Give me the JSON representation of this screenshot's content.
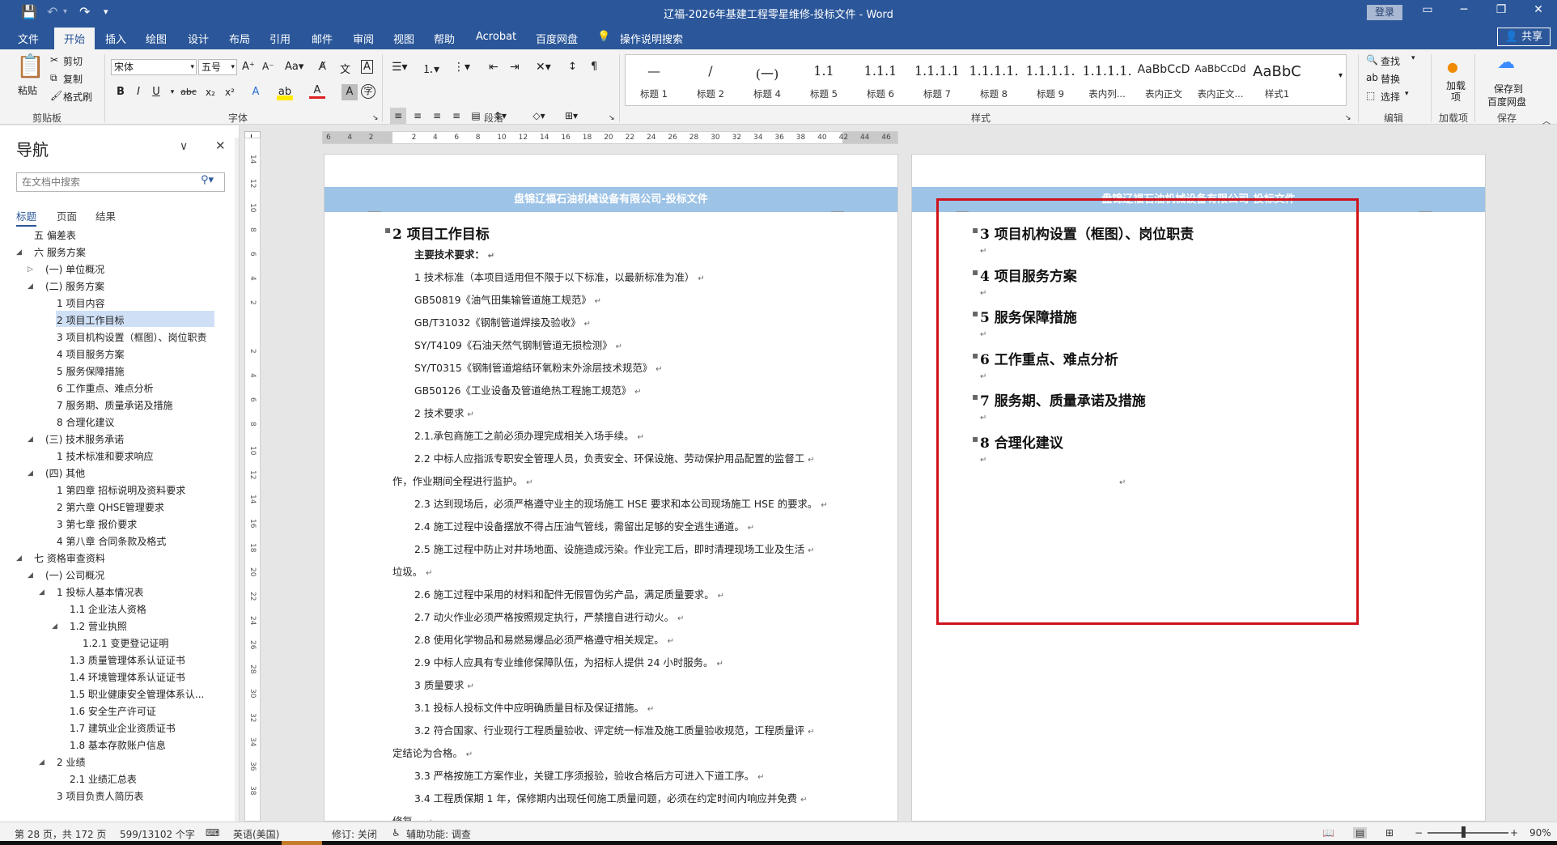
{
  "title_bar": {
    "title": "辽福-2026年基建工程零星维修-投标文件 - Word",
    "login": "登录",
    "save_icon": "save-icon",
    "undo_icon": "undo-icon",
    "redo_icon": "redo-icon"
  },
  "tabs": [
    "文件",
    "开始",
    "插入",
    "绘图",
    "设计",
    "布局",
    "引用",
    "邮件",
    "审阅",
    "视图",
    "帮助",
    "Acrobat",
    "百度网盘"
  ],
  "active_tab": "开始",
  "tell_me": "操作说明搜索",
  "share": "共享",
  "ribbon": {
    "clipboard": {
      "paste": "粘贴",
      "cut": "剪切",
      "copy": "复制",
      "format_painter": "格式刷",
      "label": "剪贴板"
    },
    "font": {
      "font_name": "宋体",
      "font_size": "五号",
      "label": "字体"
    },
    "paragraph": {
      "label": "段落"
    },
    "styles": {
      "label": "样式",
      "items": [
        {
          "preview": "—",
          "name": "标题 1"
        },
        {
          "preview": "/",
          "name": "标题 2"
        },
        {
          "preview": "(一)",
          "name": "标题 4"
        },
        {
          "preview": "1.1",
          "name": "标题 5"
        },
        {
          "preview": "1.1.1",
          "name": "标题 6"
        },
        {
          "preview": "1.1.1.1",
          "name": "标题 7"
        },
        {
          "preview": "1.1.1.1.",
          "name": "标题 8"
        },
        {
          "preview": "1.1.1.1.",
          "name": "标题 9"
        },
        {
          "preview": "1.1.1.1.",
          "name": "表内列..."
        },
        {
          "preview": "AaBbCcD",
          "name": "表内正文"
        },
        {
          "preview": "AaBbCcDd",
          "name": "表内正文..."
        },
        {
          "preview": "AaBbCcD",
          "name": "样式1"
        },
        {
          "preview": "AaBbC",
          "name": "样式1"
        }
      ]
    },
    "editing": {
      "find": "查找",
      "replace": "替换",
      "select": "选择",
      "label": "编辑"
    },
    "addins": {
      "btn": "加载项",
      "label": "加载项"
    },
    "save_baidu": {
      "btn1": "保存到",
      "btn2": "百度网盘",
      "label": "保存"
    }
  },
  "nav": {
    "title": "导航",
    "search_placeholder": "在文档中搜索",
    "tabs": [
      "标题",
      "页面",
      "结果"
    ],
    "items": [
      {
        "text": "五 偏差表",
        "level": 1,
        "tri": ""
      },
      {
        "text": "六 服务方案",
        "level": 1,
        "tri": "◢"
      },
      {
        "text": "(一) 单位概况",
        "level": 2,
        "tri": "▷"
      },
      {
        "text": "(二) 服务方案",
        "level": 2,
        "tri": "◢"
      },
      {
        "text": "1 项目内容",
        "level": 3,
        "tri": ""
      },
      {
        "text": "2 项目工作目标",
        "level": 3,
        "tri": ""
      },
      {
        "text": "3 项目机构设置（框图）、岗位职责",
        "level": 3,
        "tri": ""
      },
      {
        "text": "4 项目服务方案",
        "level": 3,
        "tri": ""
      },
      {
        "text": "5 服务保障措施",
        "level": 3,
        "tri": ""
      },
      {
        "text": "6 工作重点、难点分析",
        "level": 3,
        "tri": ""
      },
      {
        "text": "7 服务期、质量承诺及措施",
        "level": 3,
        "tri": ""
      },
      {
        "text": "8 合理化建议",
        "level": 3,
        "tri": ""
      },
      {
        "text": "(三) 技术服务承诺",
        "level": 2,
        "tri": "◢"
      },
      {
        "text": "1 技术标准和要求响应",
        "level": 3,
        "tri": ""
      },
      {
        "text": "(四) 其他",
        "level": 2,
        "tri": "◢"
      },
      {
        "text": "1 第四章  招标说明及资料要求",
        "level": 3,
        "tri": ""
      },
      {
        "text": "2 第六章  QHSE管理要求",
        "level": 3,
        "tri": ""
      },
      {
        "text": "3 第七章  报价要求",
        "level": 3,
        "tri": ""
      },
      {
        "text": "4 第八章  合同条款及格式",
        "level": 3,
        "tri": ""
      },
      {
        "text": "七 资格审查资料",
        "level": 1,
        "tri": "◢"
      },
      {
        "text": "(一) 公司概况",
        "level": 2,
        "tri": "◢"
      },
      {
        "text": "1 投标人基本情况表",
        "level": 3,
        "tri": "◢"
      },
      {
        "text": "1.1 企业法人资格",
        "level": 4,
        "tri": ""
      },
      {
        "text": "1.2 营业执照",
        "level": 4,
        "tri": "◢"
      },
      {
        "text": "1.2.1 变更登记证明",
        "level": 5,
        "tri": ""
      },
      {
        "text": "1.3 质量管理体系认证证书",
        "level": 4,
        "tri": ""
      },
      {
        "text": "1.4 环境管理体系认证证书",
        "level": 4,
        "tri": ""
      },
      {
        "text": "1.5 职业健康安全管理体系认...",
        "level": 4,
        "tri": ""
      },
      {
        "text": "1.6 安全生产许可证",
        "level": 4,
        "tri": ""
      },
      {
        "text": "1.7 建筑业企业资质证书",
        "level": 4,
        "tri": ""
      },
      {
        "text": "1.8 基本存款账户信息",
        "level": 4,
        "tri": ""
      },
      {
        "text": "2 业绩",
        "level": 3,
        "tri": "◢"
      },
      {
        "text": "2.1 业绩汇总表",
        "level": 4,
        "tri": ""
      },
      {
        "text": "3 项目负责人简历表",
        "level": 3,
        "tri": ""
      }
    ]
  },
  "ruler": {
    "h_ticks": [
      "6",
      "4",
      "2",
      "",
      "2",
      "4",
      "6",
      "8",
      "10",
      "12",
      "14",
      "16",
      "18",
      "20",
      "22",
      "24",
      "26",
      "28",
      "30",
      "32",
      "34",
      "36",
      "38",
      "40",
      "42",
      "44",
      "46"
    ],
    "v_ticks": [
      "14",
      "12",
      "10",
      "8",
      "6",
      "4",
      "2",
      "",
      "2",
      "4",
      "6",
      "8",
      "10",
      "12",
      "14",
      "16",
      "18",
      "20",
      "22",
      "24",
      "26",
      "28",
      "30",
      "32",
      "34",
      "36",
      "38"
    ],
    "corner": "L"
  },
  "page1": {
    "header": "盘锦辽福石油机械设备有限公司-投标文件",
    "heading": "2  项目工作目标",
    "lines": [
      "主要技术要求：",
      "1 技术标准（本项目适用但不限于以下标准，以最新标准为准）",
      "GB50819《油气田集输管道施工规范》",
      "GB/T31032《钢制管道焊接及验收》",
      "SY/T4109《石油天然气钢制管道无损检测》",
      "SY/T0315《钢制管道熔结环氧粉末外涂层技术规范》",
      "GB50126《工业设备及管道绝热工程施工规范》",
      "2 技术要求",
      "2.1.承包商施工之前必须办理完成相关入场手续。",
      "2.2 中标人应指派专职安全管理人员，负责安全、环保设施、劳动保护用品配置的监督工",
      "作，作业期间全程进行监护。",
      "2.3 达到现场后，必须严格遵守业主的现场施工 HSE 要求和本公司现场施工 HSE 的要求。",
      "2.4 施工过程中设备摆放不得占压油气管线，需留出足够的安全逃生通道。",
      "2.5 施工过程中防止对井场地面、设施造成污染。作业完工后，即时清理现场工业及生活",
      "垃圾。",
      "2.6 施工过程中采用的材料和配件无假冒伪劣产品，满足质量要求。",
      "2.7 动火作业必须严格按照规定执行，严禁擅自进行动火。",
      "2.8 使用化学物品和易燃易爆品必须严格遵守相关规定。",
      "2.9 中标人应具有专业维修保障队伍，为招标人提供 24 小时服务。",
      "3 质量要求",
      "3.1 投标人投标文件中应明确质量目标及保证措施。",
      "3.2 符合国家、行业现行工程质量验收、评定统一标准及施工质量验收规范，工程质量评",
      "定结论为合格。",
      "3.3  严格按施工方案作业，关键工序须报验，验收合格后方可进入下道工序。",
      "3.4  工程质保期 1 年，保修期内出现任何施工质量问题，必须在约定时间内响应并免费",
      "修复。"
    ]
  },
  "page2": {
    "header": "盘锦辽福石油机械设备有限公司-投标文件",
    "headings": [
      "3  项目机构设置（框图）、岗位职责",
      "4  项目服务方案",
      "5  服务保障措施",
      "6  工作重点、难点分析",
      "7  服务期、质量承诺及措施",
      "8  合理化建议"
    ]
  },
  "status": {
    "page": "第 28 页，共 172 页",
    "words": "599/13102 个字",
    "lang": "英语(美国)",
    "track": "修订: 关闭",
    "access": "辅助功能: 调查",
    "zoom": "90%"
  },
  "colors": {
    "word_blue": "#2b579a",
    "header_band": "#9dc3e6",
    "highlight_box": "#d0121b"
  }
}
